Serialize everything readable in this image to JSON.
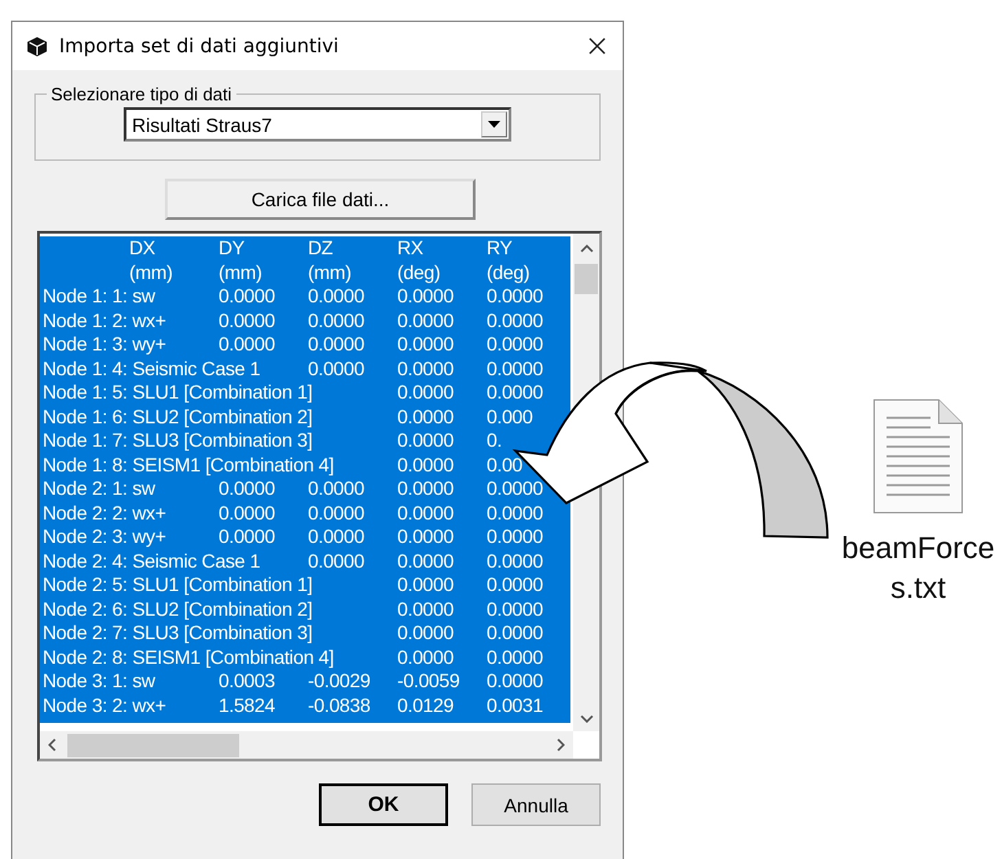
{
  "window": {
    "title": "Importa set di dati aggiuntivi"
  },
  "data_type": {
    "legend": "Selezionare tipo di dati",
    "value": "Risultati Straus7"
  },
  "load_button": "Carica file dati...",
  "list": {
    "headers": [
      [
        "DX",
        "(mm)"
      ],
      [
        "DY",
        "(mm)"
      ],
      [
        "DZ",
        "(mm)"
      ],
      [
        "RX",
        "(deg)"
      ],
      [
        "RY",
        "(deg)"
      ]
    ],
    "rows": [
      {
        "label": "Node 1: 1: sw",
        "values": [
          "0.0000",
          "0.0000",
          "0.0000",
          "0.0000"
        ],
        "selected": true
      },
      {
        "label": "Node 1: 2: wx+",
        "values": [
          "0.0000",
          "0.0000",
          "0.0000",
          "0.0000"
        ],
        "selected": true
      },
      {
        "label": "Node 1: 3: wy+",
        "values": [
          "0.0000",
          "0.0000",
          "0.0000",
          "0.0000"
        ],
        "selected": true
      },
      {
        "label": "Node 1: 4: Seismic Case 1",
        "values": [
          "0.0000",
          "0.0000",
          "0.0000"
        ],
        "selected": true
      },
      {
        "label": "Node 1: 5: SLU1 [Combination 1]",
        "values": [
          "0.0000",
          "0.0000"
        ],
        "selected": true
      },
      {
        "label": "Node 1: 6: SLU2 [Combination 2]",
        "values": [
          "0.0000",
          "0.000"
        ],
        "selected": true
      },
      {
        "label": "Node 1: 7: SLU3 [Combination 3]",
        "values": [
          "0.0000",
          "0."
        ],
        "selected": true
      },
      {
        "label": "Node 1: 8: SEISM1 [Combination 4]",
        "values": [
          "0.0000",
          "0.00"
        ],
        "selected": true
      },
      {
        "label": "Node 2: 1: sw",
        "values": [
          "0.0000",
          "0.0000",
          "0.0000",
          "0.0000"
        ],
        "selected": true
      },
      {
        "label": "Node 2: 2: wx+",
        "values": [
          "0.0000",
          "0.0000",
          "0.0000",
          "0.0000"
        ],
        "selected": true
      },
      {
        "label": "Node 2: 3: wy+",
        "values": [
          "0.0000",
          "0.0000",
          "0.0000",
          "0.0000"
        ],
        "selected": true
      },
      {
        "label": "Node 2: 4: Seismic Case 1",
        "values": [
          "0.0000",
          "0.0000",
          "0.0000"
        ],
        "selected": true
      },
      {
        "label": "Node 2: 5: SLU1 [Combination 1]",
        "values": [
          "0.0000",
          "0.0000"
        ],
        "selected": true
      },
      {
        "label": "Node 2: 6: SLU2 [Combination 2]",
        "values": [
          "0.0000",
          "0.0000"
        ],
        "selected": true
      },
      {
        "label": "Node 2: 7: SLU3 [Combination 3]",
        "values": [
          "0.0000",
          "0.0000"
        ],
        "selected": true
      },
      {
        "label": "Node 2: 8: SEISM1 [Combination 4]",
        "values": [
          "0.0000",
          "0.0000"
        ],
        "selected": true
      },
      {
        "label": "Node 3: 1: sw",
        "values": [
          "0.0003",
          "-0.0029",
          "-0.0059",
          "0.0000"
        ],
        "selected": true
      },
      {
        "label": "Node 3: 2: wx+",
        "values": [
          "1.5824",
          "-0.0838",
          "0.0129",
          "0.0031"
        ],
        "selected": true
      }
    ]
  },
  "buttons": [
    {
      "label": "OK",
      "default": true
    },
    {
      "label": "Annulla",
      "default": false
    }
  ],
  "file": {
    "name": "beamForces.txt"
  }
}
